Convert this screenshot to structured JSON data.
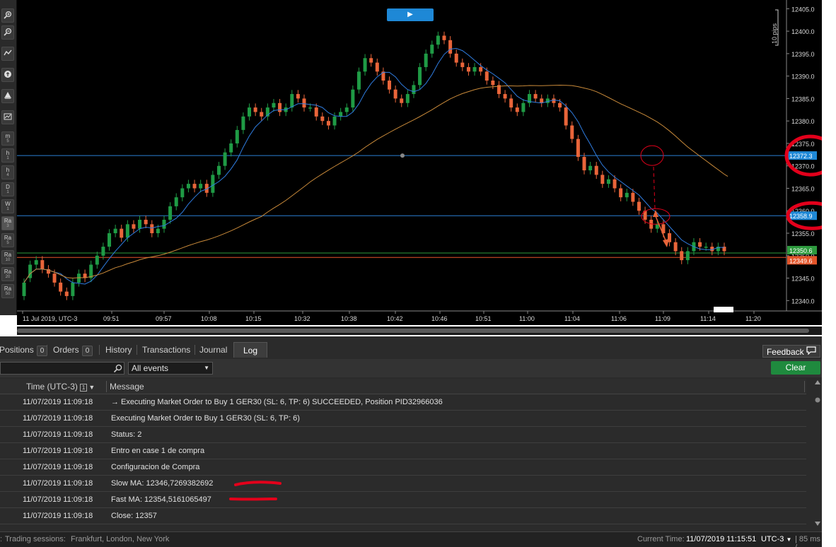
{
  "toolbar": {
    "items": [
      {
        "icon": "zoom-in-icon",
        "label": "",
        "sub": ""
      },
      {
        "icon": "zoom-out-icon",
        "label": "",
        "sub": ""
      },
      {
        "icon": "indicators-icon",
        "label": "",
        "sub": ""
      },
      {
        "icon": "objects-icon",
        "label": "",
        "sub": ""
      },
      {
        "icon": "drawing-icon",
        "label": "",
        "sub": ""
      },
      {
        "icon": "chart-settings-icon",
        "label": "",
        "sub": ""
      },
      {
        "icon": "",
        "label": "m",
        "sub": "5"
      },
      {
        "icon": "",
        "label": "h",
        "sub": "1"
      },
      {
        "icon": "",
        "label": "h",
        "sub": "4"
      },
      {
        "icon": "",
        "label": "D",
        "sub": "1"
      },
      {
        "icon": "",
        "label": "W",
        "sub": "1"
      },
      {
        "icon": "",
        "label": "Ra",
        "sub": "3"
      },
      {
        "icon": "",
        "label": "Ra",
        "sub": "5"
      },
      {
        "icon": "",
        "label": "Ra",
        "sub": "10"
      },
      {
        "icon": "",
        "label": "Ra",
        "sub": "20"
      },
      {
        "icon": "",
        "label": "Ra",
        "sub": "50"
      }
    ]
  },
  "chart": {
    "play_label": "▶",
    "pips_label": "10 pips",
    "price_ticks": [
      "12405.0",
      "12400.0",
      "12395.0",
      "12390.0",
      "12385.0",
      "12380.0",
      "12375.0",
      "12370.0",
      "12365.0",
      "12360.0",
      "12355.0",
      "12350.0",
      "12345.0",
      "12340.0"
    ],
    "time_ticks": [
      "11 Jul 2019, UTC-3",
      "09:51",
      "09:57",
      "10:08",
      "10:15",
      "10:32",
      "10:38",
      "10:42",
      "10:46",
      "10:51",
      "11:00",
      "11:04",
      "11:06",
      "11:09",
      "11:14",
      "11:20"
    ],
    "price_labels": [
      {
        "text": "12372.3",
        "color": "#1e88d6",
        "price": 12372.3
      },
      {
        "text": "12358.9",
        "color": "#1e88d6",
        "price": 12358.9
      },
      {
        "text": "12350.6",
        "color": "#2e9a3e",
        "price": 12350.6
      },
      {
        "text": "12349.6",
        "color": "#e3552a",
        "price": 12349.6
      }
    ],
    "colors": {
      "bull": "#1f9b45",
      "bear": "#e9653a",
      "fast_ma": "#2f7de1",
      "slow_ma": "#c98a3a",
      "hline": "#2a7fd4"
    }
  },
  "chart_data": {
    "type": "candlestick",
    "symbol": "GER30",
    "date": "11 Jul 2019",
    "timezone": "UTC-3",
    "ylim": [
      12338,
      12406
    ],
    "grid": false,
    "x_labels": [
      "09:51",
      "09:57",
      "10:08",
      "10:15",
      "10:32",
      "10:38",
      "10:42",
      "10:46",
      "10:51",
      "11:00",
      "11:04",
      "11:06",
      "11:09",
      "11:14",
      "11:20"
    ],
    "horizontal_lines": [
      12372.3,
      12358.9,
      12350.6,
      12349.6
    ],
    "series": [
      {
        "type": "candles",
        "close": [
          12344,
          12348,
          12349,
          12347,
          12346,
          12344,
          12342,
          12341,
          12344,
          12346,
          12345,
          12348,
          12350,
          12352,
          12355,
          12356,
          12354,
          12357,
          12356,
          12358,
          12357,
          12355,
          12356,
          12358,
          12361,
          12363,
          12365,
          12366,
          12365,
          12366,
          12364,
          12368,
          12370,
          12373,
          12375,
          12378,
          12381,
          12383,
          12382,
          12381,
          12383,
          12384,
          12382,
          12383,
          12386,
          12385,
          12383,
          12383,
          12381,
          12380,
          12379,
          12381,
          12382,
          12383,
          12387,
          12391,
          12394,
          12393,
          12391,
          12389,
          12387,
          12385,
          12384,
          12386,
          12388,
          12392,
          12395,
          12397,
          12399,
          12398,
          12395,
          12393,
          12392,
          12391,
          12392,
          12391,
          12389,
          12388,
          12386,
          12385,
          12383,
          12382,
          12384,
          12386,
          12385,
          12384,
          12385,
          12384,
          12383,
          12379,
          12376,
          12372,
          12369,
          12370,
          12368,
          12366,
          12367,
          12365,
          12363,
          12364,
          12362,
          12360,
          12358,
          12356,
          12357,
          12355,
          12353,
          12351,
          12349,
          12351,
          12353,
          12352,
          12352,
          12351,
          12352,
          12351
        ],
        "open": [
          12341,
          12345,
          12348,
          12349,
          12347,
          12346,
          12344,
          12342,
          12341,
          12344,
          12346,
          12345,
          12348,
          12350,
          12352,
          12355,
          12356,
          12354,
          12357,
          12356,
          12358,
          12357,
          12355,
          12356,
          12358,
          12361,
          12363,
          12365,
          12366,
          12365,
          12366,
          12364,
          12368,
          12370,
          12373,
          12375,
          12378,
          12381,
          12383,
          12382,
          12381,
          12383,
          12384,
          12382,
          12383,
          12386,
          12385,
          12383,
          12383,
          12381,
          12380,
          12379,
          12381,
          12382,
          12383,
          12387,
          12391,
          12394,
          12393,
          12391,
          12389,
          12387,
          12385,
          12384,
          12386,
          12388,
          12392,
          12395,
          12397,
          12399,
          12398,
          12395,
          12393,
          12392,
          12391,
          12392,
          12391,
          12389,
          12388,
          12386,
          12385,
          12383,
          12382,
          12384,
          12386,
          12385,
          12384,
          12385,
          12384,
          12383,
          12379,
          12376,
          12372,
          12369,
          12370,
          12368,
          12366,
          12367,
          12365,
          12363,
          12364,
          12362,
          12360,
          12358,
          12356,
          12357,
          12355,
          12353,
          12351,
          12349,
          12351,
          12353,
          12352,
          12352,
          12351,
          12352
        ]
      },
      {
        "name": "Fast MA",
        "type": "line"
      },
      {
        "name": "Slow MA",
        "type": "line"
      }
    ]
  },
  "tabs": {
    "items": [
      {
        "label": "Positions",
        "count": "0"
      },
      {
        "label": "Orders",
        "count": "0"
      },
      {
        "label": "History"
      },
      {
        "label": "Transactions"
      },
      {
        "label": "Journal"
      },
      {
        "label": "Log"
      }
    ],
    "feedback": "Feedback"
  },
  "filter": {
    "search_value": "",
    "events_value": "All events",
    "clear_label": "Clear"
  },
  "log": {
    "headers": {
      "time": "Time (UTC-3)",
      "sort_badge": "1",
      "sort_arrow": "▼",
      "message": "Message"
    },
    "rows": [
      {
        "time": "11/07/2019 11:09:18",
        "message": "→ Executing Market Order to Buy 1 GER30 (SL: 6, TP: 6) SUCCEEDED, Position PID32966036"
      },
      {
        "time": "11/07/2019 11:09:18",
        "message": "Executing Market Order to Buy 1 GER30 (SL: 6, TP: 6)"
      },
      {
        "time": "11/07/2019 11:09:18",
        "message": "Status: 2"
      },
      {
        "time": "11/07/2019 11:09:18",
        "message": "Entro en case 1 de compra"
      },
      {
        "time": "11/07/2019 11:09:18",
        "message": "Configuracion de Compra"
      },
      {
        "time": "11/07/2019 11:09:18",
        "message": "Slow MA: 12346,7269382692"
      },
      {
        "time": "11/07/2019 11:09:18",
        "message": "Fast MA: 12354,5161065497"
      },
      {
        "time": "11/07/2019 11:09:18",
        "message": "Close: 12357"
      }
    ]
  },
  "status": {
    "sessions_label": "Trading sessions:",
    "sessions_value": "Frankfurt, London, New York",
    "current_time_label": "Current Time:",
    "current_time_value": "11/07/2019 11:15:51",
    "tz": "UTC-3",
    "latency": "| 85 ms / "
  },
  "annotations": {
    "color": "#e3001b"
  }
}
